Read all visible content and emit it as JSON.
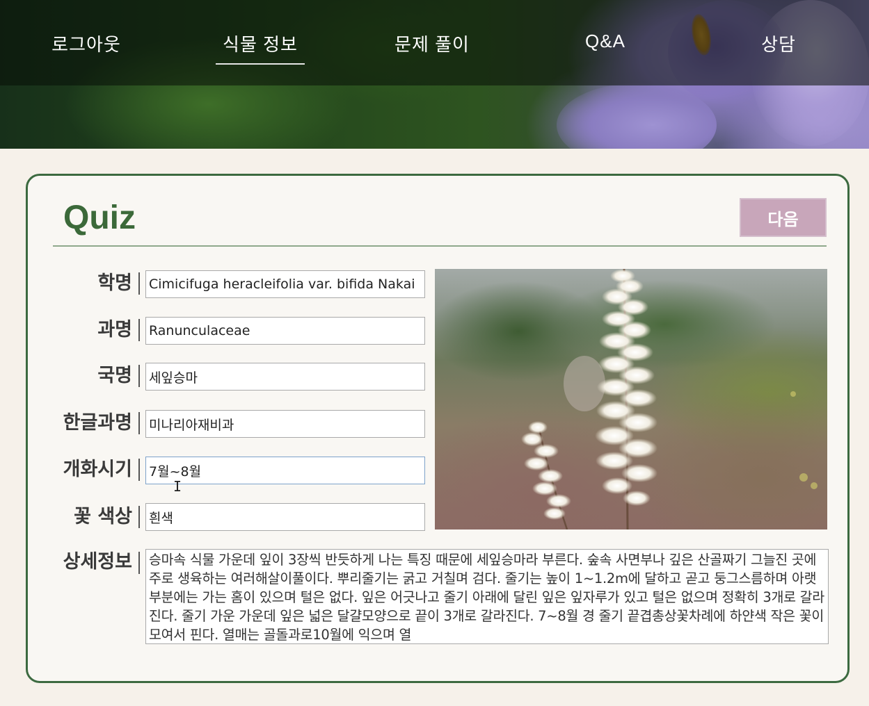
{
  "nav": {
    "items": [
      "로그아웃",
      "식물 정보",
      "문제 풀이",
      "Q&A",
      "상담"
    ],
    "active": "식물 정보"
  },
  "quiz": {
    "title": "Quiz",
    "next_label": "다음"
  },
  "fields": {
    "scientific_name": {
      "label": "학명",
      "value": "Cimicifuga heracleifolia var. bifida Nakai"
    },
    "family": {
      "label": "과명",
      "value": "Ranunculaceae"
    },
    "korean_name": {
      "label": "국명",
      "value": "세잎승마"
    },
    "korean_family": {
      "label": "한글과명",
      "value": "미나리아재비과"
    },
    "flowering": {
      "label": "개화시기",
      "value": "7월~8월"
    },
    "flower_color": {
      "label": "꽃 색상",
      "value": "흰색"
    },
    "detail": {
      "label": "상세정보",
      "value": "승마속 식물 가운데 잎이 3장씩 반듯하게 나는 특징 때문에 세잎승마라 부른다. 숲속 사면부나 깊은 산골짜기 그늘진 곳에 주로 생육하는 여러해살이풀이다. 뿌리줄기는 굵고 거칠며 검다. 줄기는 높이 1~1.2m에 달하고 곧고 둥그스름하며 아랫부분에는 가는 홈이 있으며 털은 없다. 잎은 어긋나고 줄기 아래에 달린 잎은 잎자루가 있고 털은 없으며 정확히 3개로 갈라진다. 줄기 가운 가운데 잎은 넓은 달걀모양으로 끝이 3개로 갈라진다. 7~8월 경 줄기 끝겹총상꽃차례에 하얀색 작은 꽃이 모여서 핀다. 열매는 골돌과로10월에 익으며 열"
    }
  },
  "colors": {
    "accent_green": "#3b6939",
    "next_button": "#c8a6ba",
    "page_bg": "#f6f1ea"
  }
}
